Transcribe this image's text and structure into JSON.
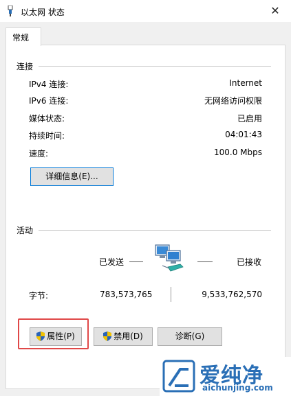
{
  "window": {
    "title": "以太网 状态",
    "close_glyph": "✕"
  },
  "tab": {
    "label": "常规"
  },
  "connection": {
    "group_label": "连接",
    "rows": [
      {
        "label": "IPv4 连接:",
        "value": "Internet"
      },
      {
        "label": "IPv6 连接:",
        "value": "无网络访问权限"
      },
      {
        "label": "媒体状态:",
        "value": "已启用"
      },
      {
        "label": "持续时间:",
        "value": "04:01:43"
      },
      {
        "label": "速度:",
        "value": "100.0 Mbps"
      }
    ],
    "details_button": "详细信息(E)..."
  },
  "activity": {
    "group_label": "活动",
    "sent_label": "已发送",
    "received_label": "已接收",
    "bytes_label": "字节:",
    "bytes_sent": "783,573,765",
    "bytes_received": "9,533,762,570",
    "icon": "network-computers-icon"
  },
  "buttons": {
    "properties": "属性(P)",
    "disable": "禁用(D)",
    "diagnose": "诊断(G)"
  },
  "watermark": {
    "text": "爱纯净",
    "url": "aichunjing.com"
  },
  "colors": {
    "highlight": "#e04848",
    "focus_border": "#0078d7",
    "watermark": "#2a6fb6"
  }
}
